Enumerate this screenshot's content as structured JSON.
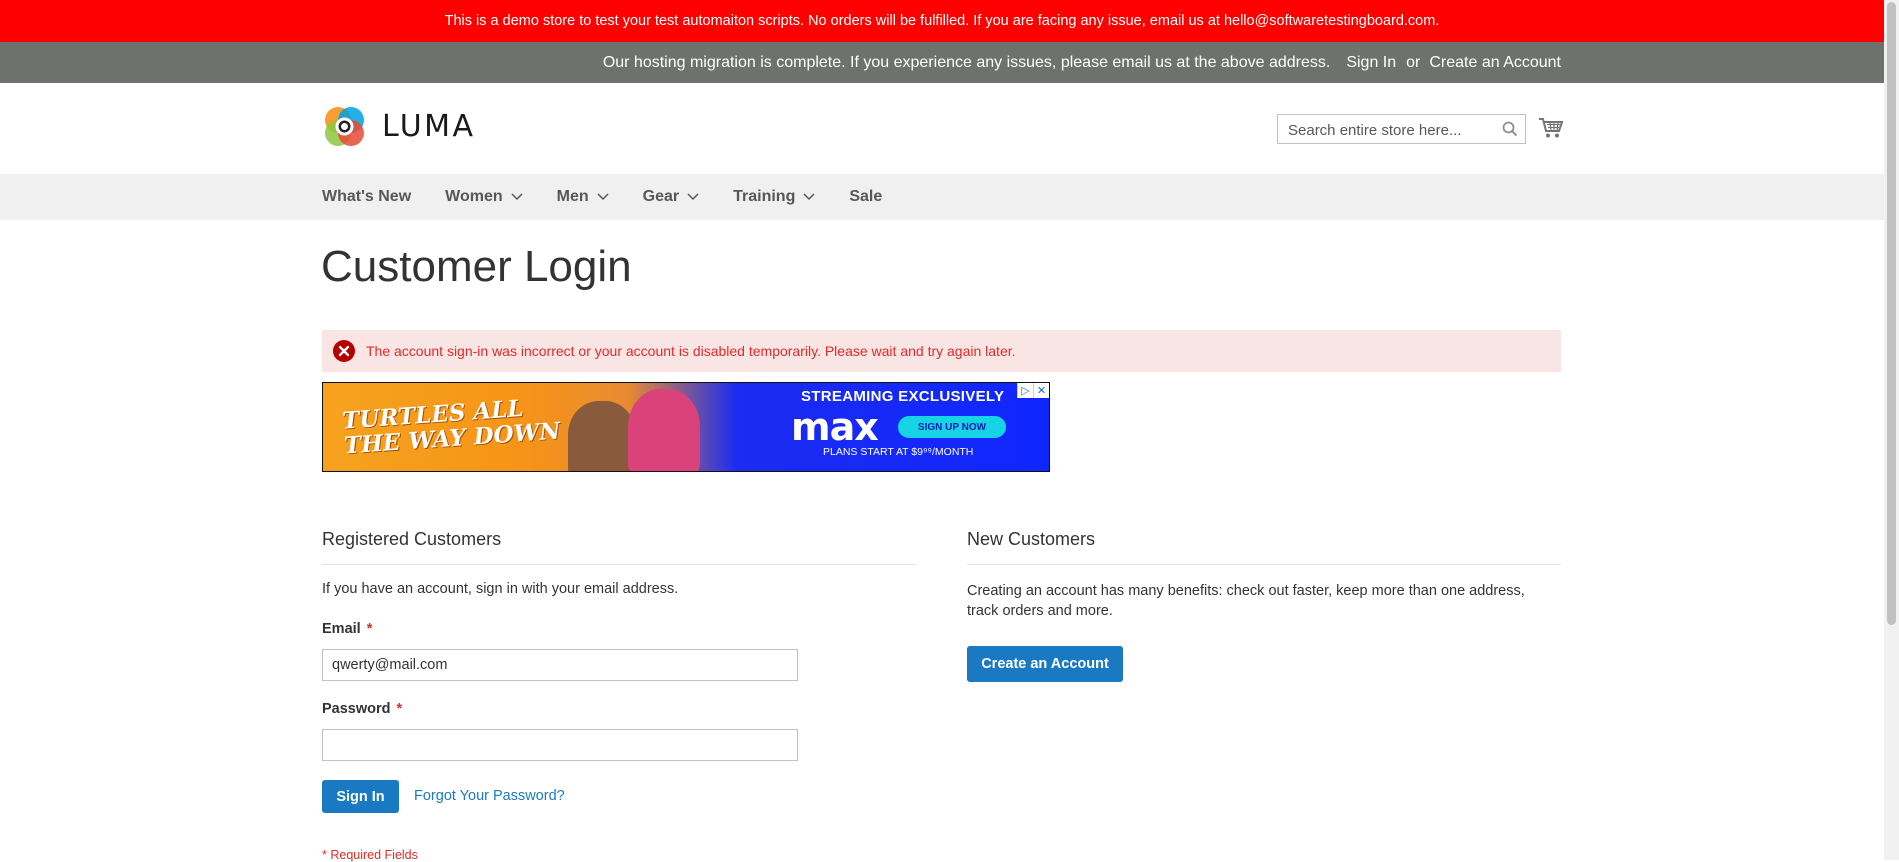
{
  "demo_notice": "This is a demo store to test your test automaiton scripts. No orders will be fulfilled. If you are facing any issue, email us at hello@softwaretestingboard.com.",
  "panel": {
    "notice": "Our hosting migration is complete. If you experience any issues, please email us at the above address.",
    "sign_in": "Sign In",
    "or": "or",
    "create_account": "Create an Account"
  },
  "logo": {
    "text": "LUMA"
  },
  "search": {
    "placeholder": "Search entire store here...",
    "value": ""
  },
  "icons": {
    "search": "search-icon",
    "cart": "cart-icon",
    "error": "error-icon",
    "chevron": "chevron-down-icon"
  },
  "nav": {
    "items": [
      {
        "label": "What's New",
        "has_dropdown": false
      },
      {
        "label": "Women",
        "has_dropdown": true
      },
      {
        "label": "Men",
        "has_dropdown": true
      },
      {
        "label": "Gear",
        "has_dropdown": true
      },
      {
        "label": "Training",
        "has_dropdown": true
      },
      {
        "label": "Sale",
        "has_dropdown": false
      }
    ]
  },
  "page_title": "Customer Login",
  "error_message": "The account sign-in was incorrect or your account is disabled temporarily. Please wait and try again later.",
  "ad": {
    "left_line1": "TURTLES ALL",
    "left_line2": "THE WAY DOWN",
    "streaming": "STREAMING EXCLUSIVELY",
    "brand": "max",
    "cta": "SIGN UP NOW",
    "plans": "PLANS START AT $9⁹⁹/MONTH",
    "adchoices": "▷",
    "close": "✕"
  },
  "registered": {
    "title": "Registered Customers",
    "intro": "If you have an account, sign in with your email address.",
    "email_label": "Email",
    "email_value": "qwerty@mail.com",
    "password_label": "Password",
    "password_value": "",
    "required_mark": "*",
    "sign_in_button": "Sign In",
    "forgot_link": "Forgot Your Password?",
    "required_note": "* Required Fields"
  },
  "new_customers": {
    "title": "New Customers",
    "text": "Creating an account has many benefits: check out faster, keep more than one address, track orders and more.",
    "create_button": "Create an Account"
  },
  "colors": {
    "demo_bar": "#ff0000",
    "panel_header": "#6e716e",
    "primary": "#1979c3",
    "error_text": "#e02b27",
    "error_bg": "#fae5e5",
    "nav_bg": "#f0f0f0"
  }
}
